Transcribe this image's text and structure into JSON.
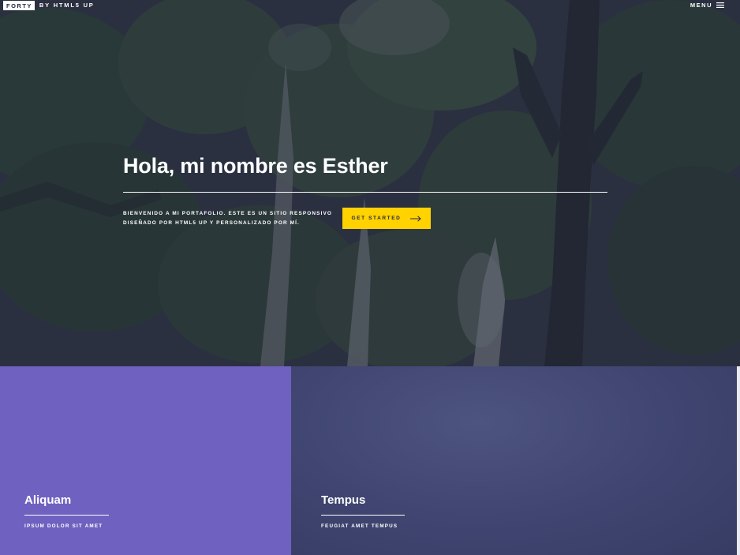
{
  "header": {
    "logo_box": "FORTY",
    "logo_by": "BY HTML5 UP",
    "menu_label": "MENU",
    "menu_icon": "hamburger-icon"
  },
  "banner": {
    "title": "Hola, mi nombre es Esther",
    "text_line_1": "BIENVENIDO A MI PORTAFOLIO. ESTE ES UN SITIO RESPONSIVO",
    "text_line_2": "DISEÑADO POR HTML5 UP Y PERSONALIZADO POR MÍ.",
    "cta_label": "GET STARTED",
    "cta_icon": "arrow-right-icon",
    "background": "forest-photo"
  },
  "tiles": [
    {
      "title": "Aliquam",
      "subtitle": "IPSUM DOLOR SIT AMET",
      "color": "#6f61c0"
    },
    {
      "title": "Tempus",
      "subtitle": "FEUGIAT AMET TEMPUS",
      "color": "#40466f"
    }
  ],
  "colors": {
    "accent": "#ffd200",
    "overlay": "#242943",
    "text": "#ffffff"
  }
}
